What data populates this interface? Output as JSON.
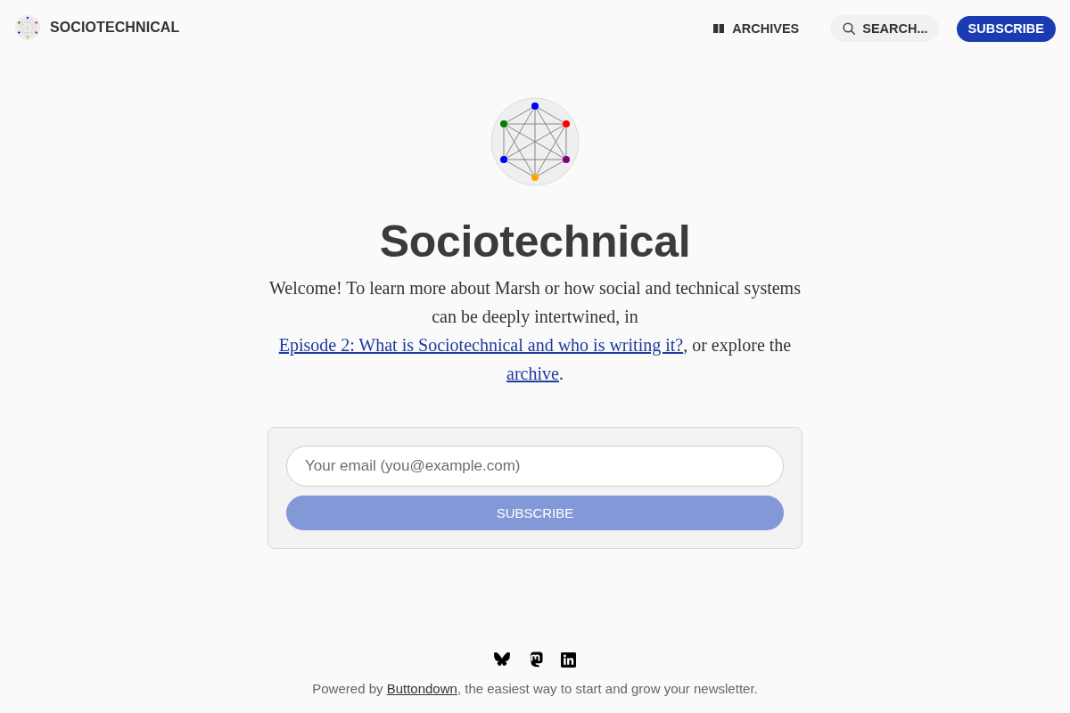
{
  "header": {
    "site_title": "SOCIOTECHNICAL",
    "nav": [
      {
        "kind": "archive",
        "label": "ARCHIVES"
      },
      {
        "kind": "search",
        "label": "SEARCH..."
      },
      {
        "kind": "subscribe",
        "label": "SUBSCRIBE"
      }
    ]
  },
  "hero": {
    "title": "Sociotechnical",
    "intro": [
      {
        "kind": "text",
        "text": "Welcome! To learn more about Marsh or how social and technical systems can be deeply intertwined, in "
      },
      {
        "kind": "link",
        "text": "Episode 2: What is Sociotechnical and who is writing it?"
      },
      {
        "kind": "text",
        "text": ", or explore the "
      },
      {
        "kind": "link",
        "text": "archive"
      },
      {
        "kind": "text",
        "text": "."
      }
    ]
  },
  "subscribe_form": {
    "placeholder": "Your email (you@example.com)",
    "button": {
      "label": "SUBSCRIBE",
      "disabled": true
    }
  },
  "footer": {
    "credit": [
      {
        "kind": "text",
        "text": "Powered by "
      },
      {
        "kind": "link",
        "text": "Buttondown"
      },
      {
        "kind": "text",
        "text": ", the easiest way to start and grow your newsletter."
      }
    ]
  }
}
